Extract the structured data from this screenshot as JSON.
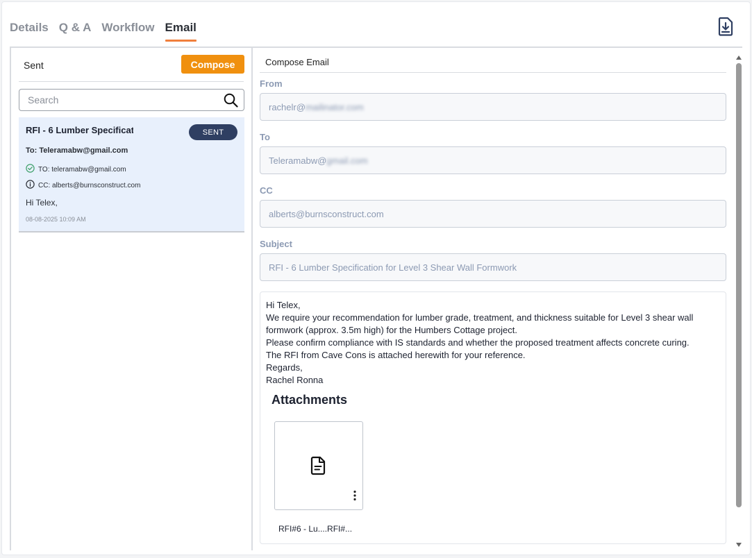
{
  "tabs": [
    {
      "label": "Details",
      "active": false
    },
    {
      "label": "Q & A",
      "active": false
    },
    {
      "label": "Workflow",
      "active": false
    },
    {
      "label": "Email",
      "active": true
    }
  ],
  "colors": {
    "accent": "#f07f3c",
    "compose": "#f0900f",
    "badge": "#2f3f62",
    "card": "#e8f0fc"
  },
  "icons": {
    "download": "download-document-icon",
    "search": "search-icon",
    "to_status": "check-circle-icon",
    "cc_status": "info-circle-icon",
    "attachment": "document-icon",
    "more": "more-vertical-icon"
  },
  "sidebar": {
    "title": "Sent",
    "compose_label": "Compose",
    "search_placeholder": "Search",
    "emails": [
      {
        "subject": "RFI - 6 Lumber Specificat",
        "status": "SENT",
        "to_line": "To: Teleramabw@gmail.com",
        "to_detail": "TO: teleramabw@gmail.com",
        "cc_detail": "CC: alberts@burnsconstruct.com",
        "preview": "Hi Telex,",
        "date": "08-08-2025 10:09 AM"
      }
    ]
  },
  "compose": {
    "title": "Compose Email",
    "from_label": "From",
    "from_value_visible": "rachelr@",
    "from_value_blurred": "mailinator.com",
    "to_label": "To",
    "to_value_visible": "Teleramabw@",
    "to_value_blurred": "gmail.com",
    "cc_label": "CC",
    "cc_value": "alberts@burnsconstruct.com",
    "subject_label": "Subject",
    "subject_value": "RFI - 6 Lumber Specification for Level 3 Shear Wall Formwork",
    "body_lines": [
      "Hi Telex,",
      "We require your recommendation for lumber grade, treatment, and thickness suitable for Level 3 shear wall formwork (approx. 3.5m high) for the Humbers Cottage project.",
      "Please confirm compliance with IS standards and whether the proposed treatment affects concrete curing.",
      "The RFI from Cave Cons is attached herewith for your reference.",
      "Regards,",
      "Rachel Ronna"
    ],
    "attachments_title": "Attachments",
    "attachments": [
      {
        "name": "RFI#6 - Lu....RFI#..."
      }
    ]
  }
}
